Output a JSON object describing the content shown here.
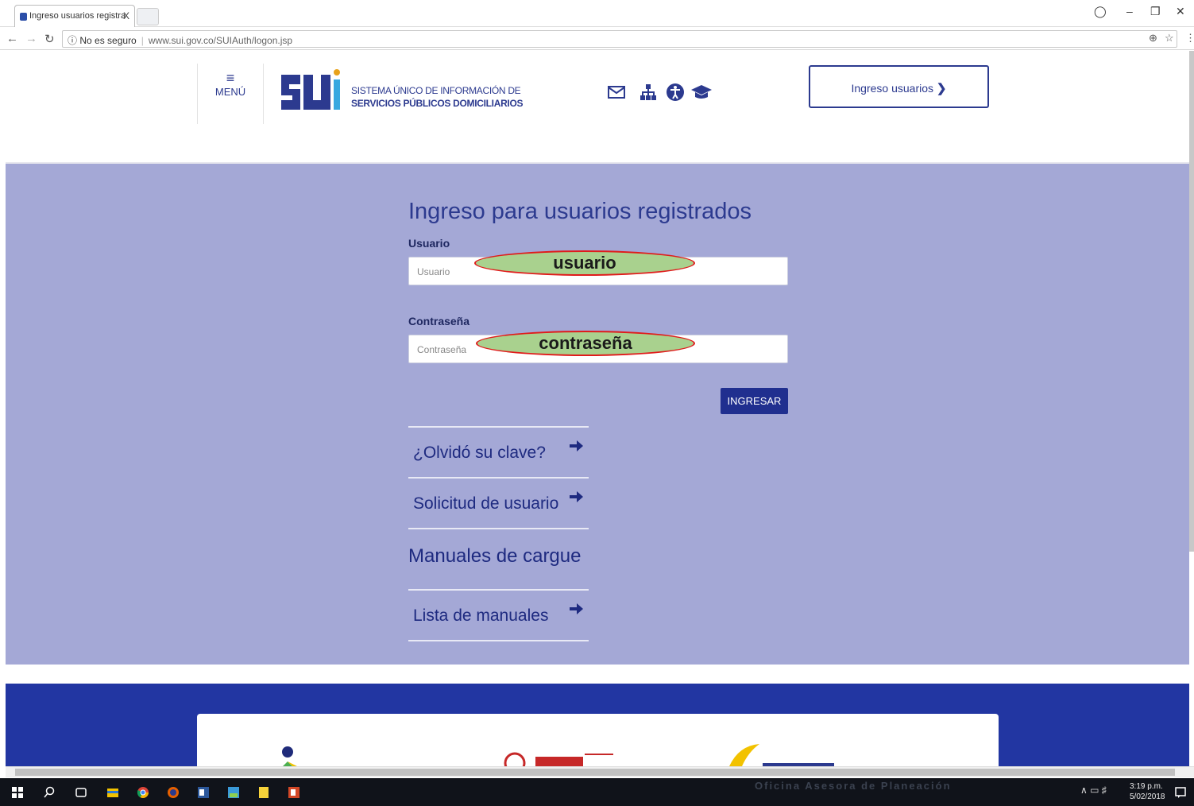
{
  "browser": {
    "tab_title": "Ingreso usuarios registra",
    "tab_close": "X",
    "security_label": "No es seguro",
    "url": "www.sui.gov.co/SUIAuth/logon.jsp"
  },
  "header": {
    "menu_label": "MENÚ",
    "logo_line1": "SISTEMA ÚNICO DE INFORMACIÓN DE",
    "logo_line2": "SERVICIOS PÚBLICOS DOMICILIARIOS",
    "login_button": "Ingreso usuarios",
    "icons": [
      "mail-icon",
      "sitemap-icon",
      "accessibility-icon",
      "graduation-cap-icon"
    ]
  },
  "login": {
    "title": "Ingreso para usuarios registrados",
    "user_label": "Usuario",
    "user_placeholder": "Usuario",
    "user_callout": "usuario",
    "password_label": "Contraseña",
    "password_placeholder": "Contraseña",
    "password_callout": "contraseña",
    "submit": "INGRESAR"
  },
  "links": {
    "forgot": "¿Olvidó su clave?",
    "request": "Solicitud de usuario",
    "manuals_title": "Manuales de cargue",
    "manual_list": "Lista de manuales"
  },
  "taskbar": {
    "watermark": "Oficina Asesora de Planeación",
    "time": "3:19 p.m.",
    "date": "5/02/2018"
  },
  "colors": {
    "primary": "#2c3a8f",
    "section_bg": "#a4a8d6",
    "footer_bg": "#2236a2",
    "callout_fill": "#a9d18e",
    "callout_border": "#e01b1b"
  }
}
